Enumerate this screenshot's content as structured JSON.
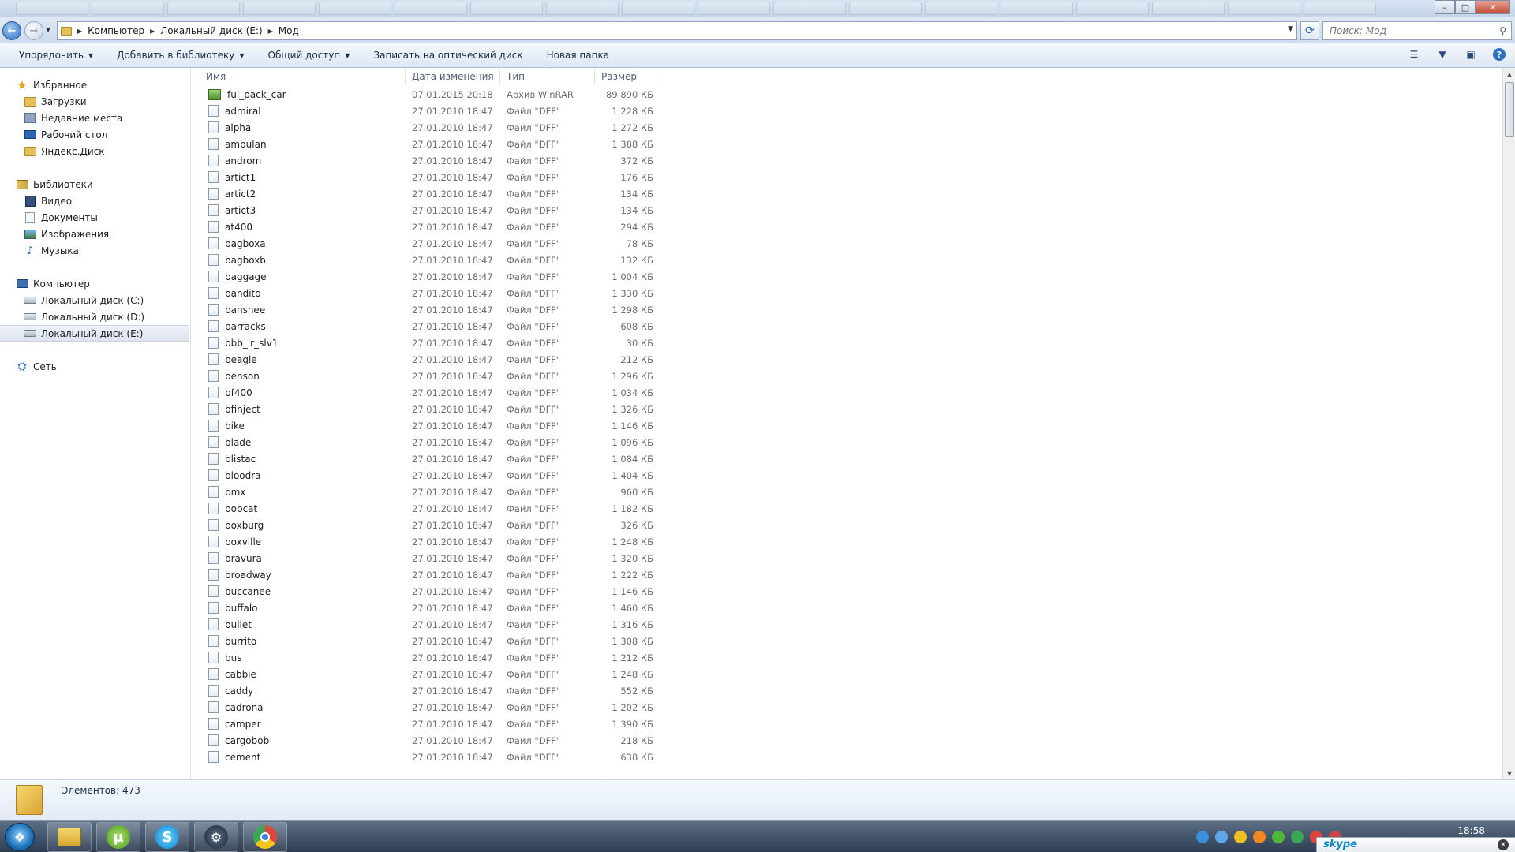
{
  "window": {
    "controls": {
      "minimize": "–",
      "maximize": "□",
      "close": "✕"
    }
  },
  "address": {
    "crumbs": [
      "Компьютер",
      "Локальный диск (E:)",
      "Мод"
    ]
  },
  "search": {
    "placeholder": "Поиск: Мод"
  },
  "toolbar": {
    "organize": "Упорядочить",
    "add_to_library": "Добавить в библиотеку",
    "share": "Общий доступ",
    "burn": "Записать на оптический диск",
    "new_folder": "Новая папка"
  },
  "nav": {
    "favorites": {
      "label": "Избранное",
      "items": [
        "Загрузки",
        "Недавние места",
        "Рабочий стол",
        "Яндекс.Диск"
      ]
    },
    "libraries": {
      "label": "Библиотеки",
      "items": [
        "Видео",
        "Документы",
        "Изображения",
        "Музыка"
      ]
    },
    "computer": {
      "label": "Компьютер",
      "items": [
        "Локальный диск (C:)",
        "Локальный диск (D:)",
        "Локальный диск (E:)"
      ],
      "selected_index": 2
    },
    "network": {
      "label": "Сеть"
    }
  },
  "columns": {
    "name": "Имя",
    "date": "Дата изменения",
    "type": "Тип",
    "size": "Размер"
  },
  "files": [
    {
      "name": "ful_pack_car",
      "date": "07.01.2015 20:18",
      "type": "Архив WinRAR",
      "size": "89 890 КБ",
      "kind": "rar"
    },
    {
      "name": "admiral",
      "date": "27.01.2010 18:47",
      "type": "Файл \"DFF\"",
      "size": "1 228 КБ"
    },
    {
      "name": "alpha",
      "date": "27.01.2010 18:47",
      "type": "Файл \"DFF\"",
      "size": "1 272 КБ"
    },
    {
      "name": "ambulan",
      "date": "27.01.2010 18:47",
      "type": "Файл \"DFF\"",
      "size": "1 388 КБ"
    },
    {
      "name": "androm",
      "date": "27.01.2010 18:47",
      "type": "Файл \"DFF\"",
      "size": "372 КБ"
    },
    {
      "name": "artict1",
      "date": "27.01.2010 18:47",
      "type": "Файл \"DFF\"",
      "size": "176 КБ"
    },
    {
      "name": "artict2",
      "date": "27.01.2010 18:47",
      "type": "Файл \"DFF\"",
      "size": "134 КБ"
    },
    {
      "name": "artict3",
      "date": "27.01.2010 18:47",
      "type": "Файл \"DFF\"",
      "size": "134 КБ"
    },
    {
      "name": "at400",
      "date": "27.01.2010 18:47",
      "type": "Файл \"DFF\"",
      "size": "294 КБ"
    },
    {
      "name": "bagboxa",
      "date": "27.01.2010 18:47",
      "type": "Файл \"DFF\"",
      "size": "78 КБ"
    },
    {
      "name": "bagboxb",
      "date": "27.01.2010 18:47",
      "type": "Файл \"DFF\"",
      "size": "132 КБ"
    },
    {
      "name": "baggage",
      "date": "27.01.2010 18:47",
      "type": "Файл \"DFF\"",
      "size": "1 004 КБ"
    },
    {
      "name": "bandito",
      "date": "27.01.2010 18:47",
      "type": "Файл \"DFF\"",
      "size": "1 330 КБ"
    },
    {
      "name": "banshee",
      "date": "27.01.2010 18:47",
      "type": "Файл \"DFF\"",
      "size": "1 298 КБ"
    },
    {
      "name": "barracks",
      "date": "27.01.2010 18:47",
      "type": "Файл \"DFF\"",
      "size": "608 КБ"
    },
    {
      "name": "bbb_lr_slv1",
      "date": "27.01.2010 18:47",
      "type": "Файл \"DFF\"",
      "size": "30 КБ"
    },
    {
      "name": "beagle",
      "date": "27.01.2010 18:47",
      "type": "Файл \"DFF\"",
      "size": "212 КБ"
    },
    {
      "name": "benson",
      "date": "27.01.2010 18:47",
      "type": "Файл \"DFF\"",
      "size": "1 296 КБ"
    },
    {
      "name": "bf400",
      "date": "27.01.2010 18:47",
      "type": "Файл \"DFF\"",
      "size": "1 034 КБ"
    },
    {
      "name": "bfinject",
      "date": "27.01.2010 18:47",
      "type": "Файл \"DFF\"",
      "size": "1 326 КБ"
    },
    {
      "name": "bike",
      "date": "27.01.2010 18:47",
      "type": "Файл \"DFF\"",
      "size": "1 146 КБ"
    },
    {
      "name": "blade",
      "date": "27.01.2010 18:47",
      "type": "Файл \"DFF\"",
      "size": "1 096 КБ"
    },
    {
      "name": "blistac",
      "date": "27.01.2010 18:47",
      "type": "Файл \"DFF\"",
      "size": "1 084 КБ"
    },
    {
      "name": "bloodra",
      "date": "27.01.2010 18:47",
      "type": "Файл \"DFF\"",
      "size": "1 404 КБ"
    },
    {
      "name": "bmx",
      "date": "27.01.2010 18:47",
      "type": "Файл \"DFF\"",
      "size": "960 КБ"
    },
    {
      "name": "bobcat",
      "date": "27.01.2010 18:47",
      "type": "Файл \"DFF\"",
      "size": "1 182 КБ"
    },
    {
      "name": "boxburg",
      "date": "27.01.2010 18:47",
      "type": "Файл \"DFF\"",
      "size": "326 КБ"
    },
    {
      "name": "boxville",
      "date": "27.01.2010 18:47",
      "type": "Файл \"DFF\"",
      "size": "1 248 КБ"
    },
    {
      "name": "bravura",
      "date": "27.01.2010 18:47",
      "type": "Файл \"DFF\"",
      "size": "1 320 КБ"
    },
    {
      "name": "broadway",
      "date": "27.01.2010 18:47",
      "type": "Файл \"DFF\"",
      "size": "1 222 КБ"
    },
    {
      "name": "buccanee",
      "date": "27.01.2010 18:47",
      "type": "Файл \"DFF\"",
      "size": "1 146 КБ"
    },
    {
      "name": "buffalo",
      "date": "27.01.2010 18:47",
      "type": "Файл \"DFF\"",
      "size": "1 460 КБ"
    },
    {
      "name": "bullet",
      "date": "27.01.2010 18:47",
      "type": "Файл \"DFF\"",
      "size": "1 316 КБ"
    },
    {
      "name": "burrito",
      "date": "27.01.2010 18:47",
      "type": "Файл \"DFF\"",
      "size": "1 308 КБ"
    },
    {
      "name": "bus",
      "date": "27.01.2010 18:47",
      "type": "Файл \"DFF\"",
      "size": "1 212 КБ"
    },
    {
      "name": "cabbie",
      "date": "27.01.2010 18:47",
      "type": "Файл \"DFF\"",
      "size": "1 248 КБ"
    },
    {
      "name": "caddy",
      "date": "27.01.2010 18:47",
      "type": "Файл \"DFF\"",
      "size": "552 КБ"
    },
    {
      "name": "cadrona",
      "date": "27.01.2010 18:47",
      "type": "Файл \"DFF\"",
      "size": "1 202 КБ"
    },
    {
      "name": "camper",
      "date": "27.01.2010 18:47",
      "type": "Файл \"DFF\"",
      "size": "1 390 КБ"
    },
    {
      "name": "cargobob",
      "date": "27.01.2010 18:47",
      "type": "Файл \"DFF\"",
      "size": "218 КБ"
    },
    {
      "name": "cement",
      "date": "27.01.2010 18:47",
      "type": "Файл \"DFF\"",
      "size": "638 КБ"
    }
  ],
  "status": {
    "items_count": "Элементов: 473"
  },
  "taskbar": {
    "clock": "18:58",
    "skype_label": "skype"
  },
  "colors": {
    "selection": "#dde4ed",
    "accent": "#2f6fc2",
    "text_muted": "#6d6d6d"
  }
}
